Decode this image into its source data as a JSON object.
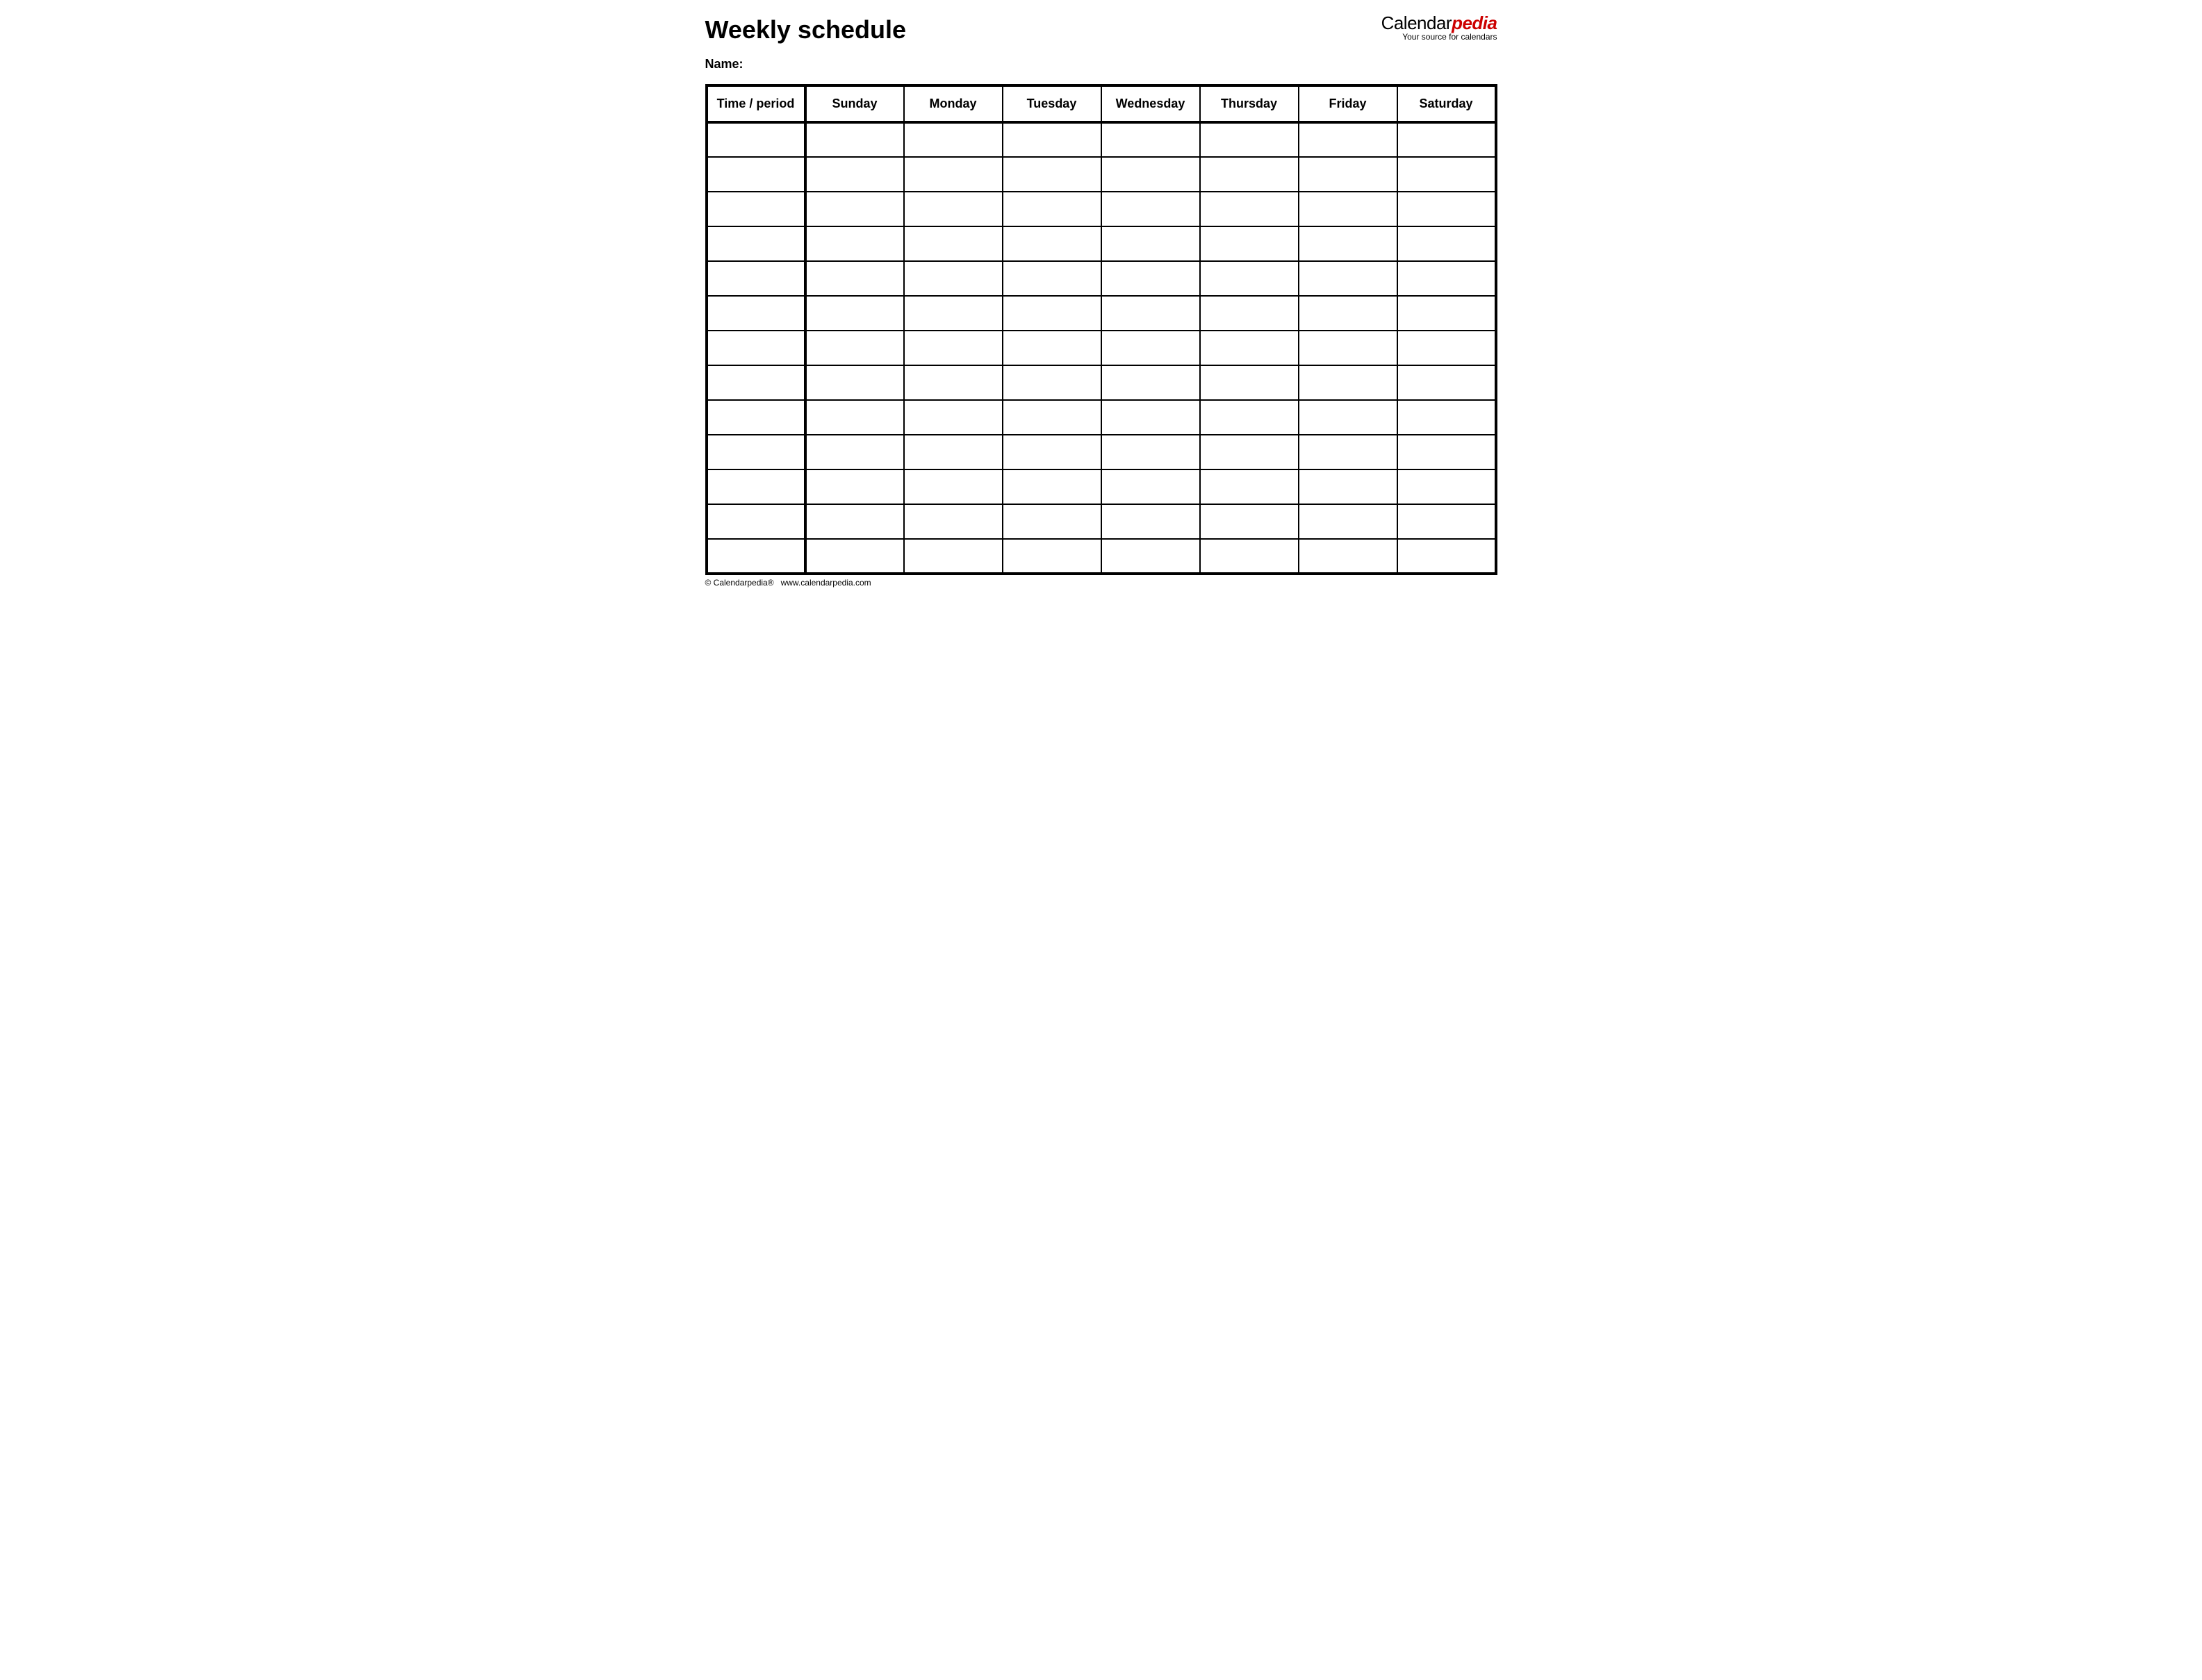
{
  "header": {
    "title": "Weekly schedule",
    "brand_part1": "Calendar",
    "brand_part2": "pedia",
    "brand_sub": "Your source for calendars"
  },
  "name_label": "Name:",
  "columns": {
    "time": "Time / period",
    "days": [
      "Sunday",
      "Monday",
      "Tuesday",
      "Wednesday",
      "Thursday",
      "Friday",
      "Saturday"
    ]
  },
  "rows": [
    {
      "time": "",
      "cells": [
        "",
        "",
        "",
        "",
        "",
        "",
        ""
      ]
    },
    {
      "time": "",
      "cells": [
        "",
        "",
        "",
        "",
        "",
        "",
        ""
      ]
    },
    {
      "time": "",
      "cells": [
        "",
        "",
        "",
        "",
        "",
        "",
        ""
      ]
    },
    {
      "time": "",
      "cells": [
        "",
        "",
        "",
        "",
        "",
        "",
        ""
      ]
    },
    {
      "time": "",
      "cells": [
        "",
        "",
        "",
        "",
        "",
        "",
        ""
      ]
    },
    {
      "time": "",
      "cells": [
        "",
        "",
        "",
        "",
        "",
        "",
        ""
      ]
    },
    {
      "time": "",
      "cells": [
        "",
        "",
        "",
        "",
        "",
        "",
        ""
      ]
    },
    {
      "time": "",
      "cells": [
        "",
        "",
        "",
        "",
        "",
        "",
        ""
      ]
    },
    {
      "time": "",
      "cells": [
        "",
        "",
        "",
        "",
        "",
        "",
        ""
      ]
    },
    {
      "time": "",
      "cells": [
        "",
        "",
        "",
        "",
        "",
        "",
        ""
      ]
    },
    {
      "time": "",
      "cells": [
        "",
        "",
        "",
        "",
        "",
        "",
        ""
      ]
    },
    {
      "time": "",
      "cells": [
        "",
        "",
        "",
        "",
        "",
        "",
        ""
      ]
    },
    {
      "time": "",
      "cells": [
        "",
        "",
        "",
        "",
        "",
        "",
        ""
      ]
    }
  ],
  "footer": {
    "copyright": "© Calendarpedia®",
    "url": "www.calendarpedia.com"
  }
}
